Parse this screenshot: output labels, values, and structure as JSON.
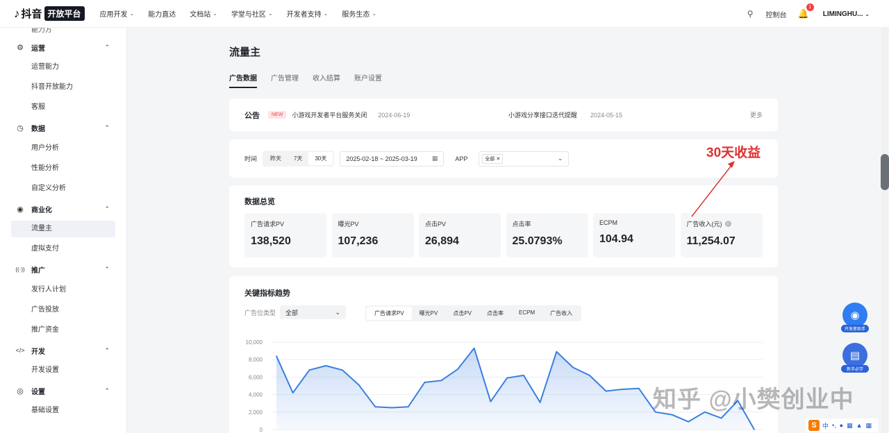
{
  "nav": {
    "logo_text": "抖音",
    "logo_badge": "开放平台",
    "menu": [
      "应用开发",
      "能力直达",
      "文档站",
      "学堂与社区",
      "开发者支持",
      "服务生态"
    ],
    "menu_has_chevron": [
      true,
      false,
      true,
      true,
      true,
      true
    ],
    "console": "控制台",
    "notification_count": "1",
    "user": "LIMINGHU..."
  },
  "sidebar": {
    "cut_item": "能力方",
    "groups": [
      {
        "label": "运营",
        "icon": "gear-icon",
        "items": [
          "运营能力",
          "抖音开放能力",
          "客服"
        ]
      },
      {
        "label": "数据",
        "icon": "clock-icon",
        "items": [
          "用户分析",
          "性能分析",
          "自定义分析"
        ]
      },
      {
        "label": "商业化",
        "icon": "commerce-icon",
        "items": [
          "流量主",
          "虚拟支付"
        ]
      },
      {
        "label": "推广",
        "icon": "broadcast-icon",
        "items": [
          "发行人计划",
          "广告投放",
          "推广资金"
        ]
      },
      {
        "label": "开发",
        "icon": "code-icon",
        "items": [
          "开发设置"
        ]
      },
      {
        "label": "设置",
        "icon": "settings-icon",
        "items": [
          "基础设置"
        ]
      }
    ],
    "active_item": "流量主"
  },
  "page": {
    "title": "流量主",
    "tabs": [
      "广告数据",
      "广告管理",
      "收入结算",
      "账户设置"
    ],
    "active_tab": 0
  },
  "notice": {
    "title": "公告",
    "badge": "NEW",
    "item1": "小游戏开发者平台服务关闭",
    "date1": "2024-06-19",
    "item2": "小游戏分享接口迭代提醒",
    "date2": "2024-05-15",
    "more": "更多"
  },
  "filter": {
    "time_label": "时间",
    "time_options": [
      "昨天",
      "7天",
      "30天"
    ],
    "time_selected": 2,
    "date_range": "2025-02-18 ~ 2025-03-19",
    "app_label": "APP",
    "app_chip": "全部"
  },
  "overview": {
    "title": "数据总览",
    "metrics": [
      {
        "label": "广告请求PV",
        "value": "138,520"
      },
      {
        "label": "曝光PV",
        "value": "107,236"
      },
      {
        "label": "点击PV",
        "value": "26,894"
      },
      {
        "label": "点击率",
        "value": "25.0793%"
      },
      {
        "label": "ECPM",
        "value": "104.94"
      },
      {
        "label": "广告收入(元)",
        "value": "11,254.07"
      }
    ]
  },
  "trend": {
    "title": "关键指标趋势",
    "adtype_label": "广告位类型",
    "adtype_value": "全部",
    "metric_tabs": [
      "广告请求PV",
      "曝光PV",
      "点击PV",
      "点击率",
      "ECPM",
      "广告收入"
    ],
    "metric_selected": 0
  },
  "chart_data": {
    "type": "area",
    "ylim": [
      0,
      10000
    ],
    "yticks": [
      "0",
      "2,000",
      "4,000",
      "6,000",
      "8,000",
      "10,000"
    ],
    "series": [
      {
        "values": [
          8400,
          4200,
          6800,
          7300,
          6800,
          5100,
          2600,
          2500,
          2600,
          5400,
          5600,
          6900,
          9300,
          3200,
          5900,
          6200,
          3100,
          8900,
          7100,
          6200,
          4400,
          4600,
          4700,
          2000,
          1700,
          900,
          2000,
          1300,
          3300,
          0
        ]
      }
    ],
    "color": "#3a7ee0"
  },
  "annotation": "30天收益",
  "watermark": "知乎 @小樊创业中",
  "float": {
    "assistant": "开发者助手",
    "newbie": "新手必学"
  },
  "ime": {
    "lang": "中"
  }
}
